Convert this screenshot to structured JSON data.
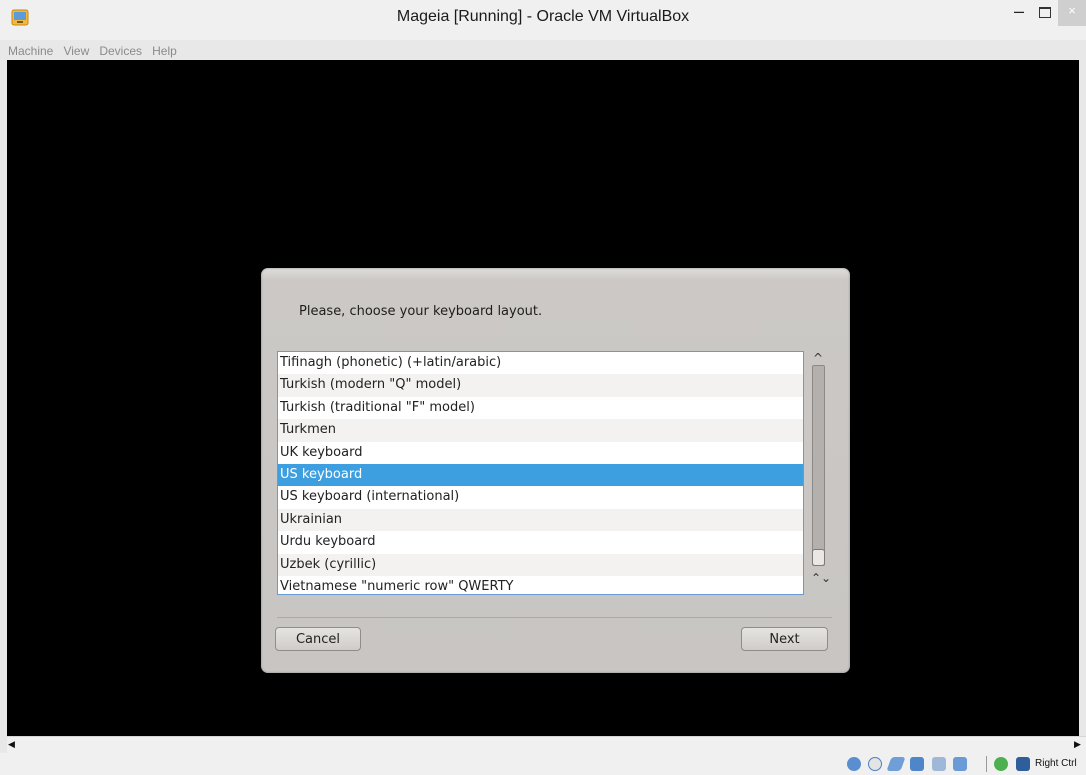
{
  "window": {
    "title": "Mageia [Running] - Oracle VM VirtualBox",
    "minimize_glyph": "–",
    "close_glyph": "×"
  },
  "menubar": {
    "items": [
      "Machine",
      "View",
      "Devices",
      "Help"
    ]
  },
  "dialog": {
    "prompt": "Please, choose your keyboard layout.",
    "layouts": [
      "Tifinagh (phonetic) (+latin/arabic)",
      "Turkish (modern \"Q\" model)",
      "Turkish (traditional \"F\" model)",
      "Turkmen",
      "UK keyboard",
      "US keyboard",
      "US keyboard (international)",
      "Ukrainian",
      "Urdu keyboard",
      "Uzbek (cyrillic)",
      "Vietnamese \"numeric row\" QWERTY"
    ],
    "selected_layout": "US keyboard",
    "scroll_up_glyph": "^",
    "scroll_down_glyph": "⌃⌄",
    "cancel_label": "Cancel",
    "next_label": "Next"
  },
  "statusbar": {
    "host_key": "Right Ctrl",
    "icons": [
      "hard-disk-icon",
      "optical-drive-icon",
      "usb-icon",
      "network-icon",
      "shared-folder-icon",
      "display-icon",
      "video-capture-icon",
      "mouse-integration-icon"
    ]
  },
  "colors": {
    "selection": "#3d9ee0",
    "vm_screen": "#000000",
    "dialog_bg": "#c8c5c2"
  }
}
